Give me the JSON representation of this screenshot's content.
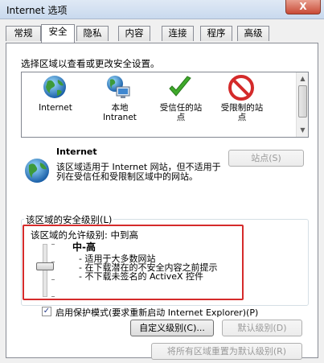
{
  "window": {
    "title": "Internet 选项",
    "close_glyph": "X"
  },
  "tabs": [
    {
      "label": "常规"
    },
    {
      "label": "安全"
    },
    {
      "label": "隐私"
    },
    {
      "label": "内容"
    },
    {
      "label": "连接"
    },
    {
      "label": "程序"
    },
    {
      "label": "高级"
    }
  ],
  "active_tab": "安全",
  "zones": {
    "caption": "选择区域以查看或更改安全设置。",
    "items": [
      {
        "label_line1": "Internet",
        "label_line2": "",
        "icon": "globe-icon"
      },
      {
        "label_line1": "本地",
        "label_line2": "Intranet",
        "icon": "intranet-icon"
      },
      {
        "label_line1": "受信任的站",
        "label_line2": "点",
        "icon": "checkmark-icon"
      },
      {
        "label_line1": "受限制的站",
        "label_line2": "点",
        "icon": "restricted-icon"
      }
    ]
  },
  "zone_info": {
    "title": "Internet",
    "description": "该区域适用于 Internet 网站，但不适用于列在受信任和受限制区域中的网站。",
    "sites_button": "站点(S)"
  },
  "security_level": {
    "group_caption": "该区域的安全级别(L)",
    "allowed_label": "该区域的允许级别: 中到高",
    "level_name": "中-高",
    "bullets": [
      "- 适用于大多数网站",
      "- 在下载潜在的不安全内容之前提示",
      "- 不下载未签名的 ActiveX 控件"
    ]
  },
  "protected_mode": {
    "label": "启用保护模式(要求重新启动 Internet Explorer)(P)",
    "checked": true
  },
  "buttons": {
    "custom_level": "自定义级别(C)...",
    "default_level": "默认级别(D)",
    "reset_all": "将所有区域重置为默认级别(R)"
  },
  "colors": {
    "highlight_frame": "#d52b2b"
  }
}
